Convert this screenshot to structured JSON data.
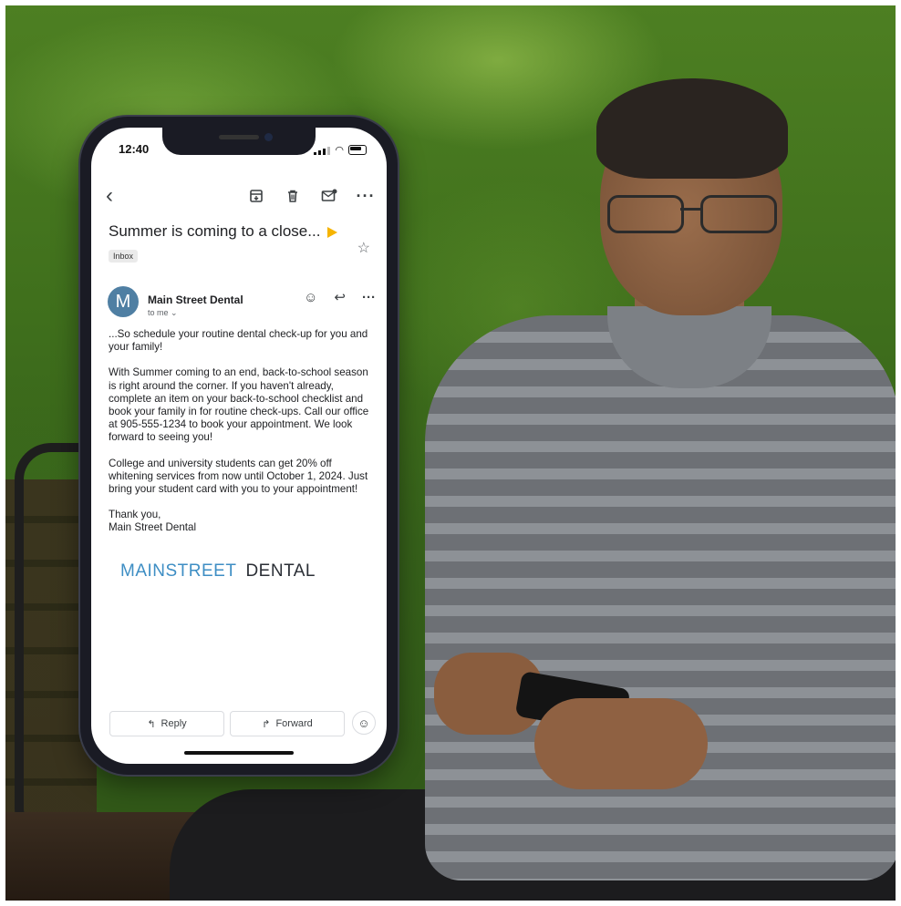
{
  "status": {
    "time": "12:40"
  },
  "email": {
    "subject": "Summer is coming to a close...",
    "label": "Inbox",
    "sender": {
      "avatar_letter": "M",
      "name": "Main Street Dental",
      "recipient": "to me ⌄"
    },
    "paragraphs": [
      "...So schedule your routine dental check-up for you and your family!",
      "With Summer coming to an end, back-to-school season is right around the corner. If you haven't already, complete an item on your back-to-school checklist and book your family in for routine check-ups. Call our office at 905-555-1234 to book your appointment. We look forward to seeing you!",
      "College and university students can get 20% off whitening services from now until October 1, 2024. Just bring your student card with you to your appointment!"
    ],
    "signoff": [
      "Thank you,",
      "Main Street Dental"
    ],
    "logo": {
      "part1": "MAINSTREET",
      "part2": "DENTAL"
    }
  },
  "actions": {
    "reply_label": "Reply",
    "forward_label": "Forward"
  },
  "icons": {
    "back": "chevron-left-icon",
    "toolbar": [
      "archive-icon",
      "trash-icon",
      "mark-unread-icon",
      "more-icon"
    ],
    "sender": [
      "emoji-icon",
      "reply-icon",
      "more-icon"
    ]
  },
  "colors": {
    "avatar": "#4f7fa3",
    "importance_marker": "#f6b400",
    "logo_accent": "#3e8ec4",
    "logo_dark": "#2b2f36"
  }
}
